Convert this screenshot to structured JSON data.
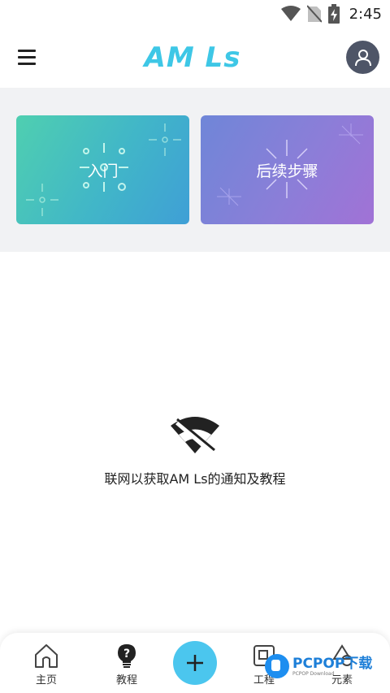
{
  "status_bar": {
    "time": "2:45"
  },
  "app_bar": {
    "logo_text": "AM Ls"
  },
  "cards": {
    "intro_label": "入门",
    "next_steps_label": "后续步骤"
  },
  "empty_state": {
    "message": "联网以获取AM Ls的通知及教程"
  },
  "bottom_nav": {
    "home_label": "主页",
    "tutorial_label": "教程",
    "project_label": "工程",
    "elements_label": "元素"
  },
  "watermark": {
    "main": "PCPOP下载",
    "sub": "PCPOP Download"
  },
  "colors": {
    "accent": "#4bc6ee",
    "logo": "#3ec7e6",
    "avatar_bg": "#4e5567",
    "intro_card": "#45bcc3",
    "next_card": "#8a7fd8"
  }
}
